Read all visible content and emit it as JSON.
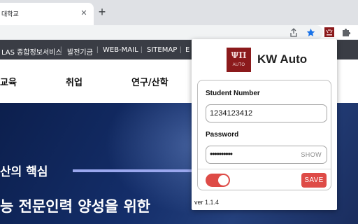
{
  "browser": {
    "tab_title": "대학교",
    "tab_close_glyph": "✕",
    "new_tab_glyph": "+",
    "icons": [
      "share-icon",
      "bookmark-star-icon",
      "extension-logo-icon",
      "puzzle-extensions-icon"
    ],
    "accent_color": "#1a73e8"
  },
  "site": {
    "top_nav": [
      "LAS 종합정보서비스",
      "발전기금",
      "WEB-MAIL",
      "SITEMAP",
      "E"
    ],
    "menu": [
      "교육",
      "취업",
      "연구/산학"
    ],
    "hero_line1": "산의 핵심",
    "hero_line2": "능 전문인력 양성을 위한"
  },
  "popup": {
    "logo_glyph": "ΨΠ",
    "logo_text": "AUTO",
    "title": "KW Auto",
    "student_number_label": "Student Number",
    "student_number_value": "1234123412",
    "password_label": "Password",
    "password_masked": "••••••••••",
    "show_label": "SHOW",
    "toggle_on": true,
    "save_label": "SAVE",
    "version": "ver 1.1.4",
    "accent_color": "#de4b47",
    "brand_color": "#8b1a1c"
  }
}
